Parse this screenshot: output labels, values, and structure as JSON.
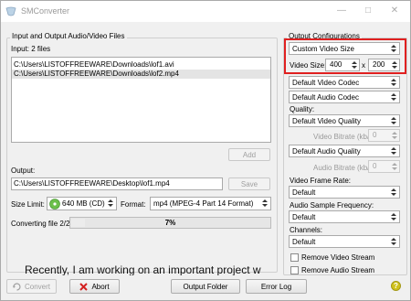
{
  "window": {
    "title": "SMConverter",
    "min_label": "—",
    "max_label": "□",
    "close_label": "✕"
  },
  "io_group": {
    "title": "Input and Output Audio/Video Files",
    "input_label": "Input: 2 files",
    "files": [
      "C:\\Users\\LISTOFFREEWARE\\Downloads\\lof1.avi",
      "C:\\Users\\LISTOFFREEWARE\\Downloads\\lof2.mp4"
    ],
    "add_label": "Add",
    "output_label": "Output:",
    "output_path": "C:\\Users\\LISTOFFREEWARE\\Desktop\\lof1.mp4",
    "save_label": "Save",
    "size_limit_label": "Size Limit:",
    "size_limit_value": "640 MB (CD)",
    "format_label": "Format:",
    "format_value": "mp4 (MPEG-4 Part 14 Format)",
    "converting_label": "Converting file 2/2",
    "progress_text": "7%",
    "progress_fraction": 0.07,
    "preview_text": "Recently, I am working on an important project w"
  },
  "config_group": {
    "title": "Output Configurations",
    "video_size_preset": "Custom Video Size",
    "video_size_label": "Video Size:",
    "video_width": "400",
    "size_x": "x",
    "video_height": "200",
    "video_codec": "Default Video Codec",
    "audio_codec": "Default Audio Codec",
    "quality_label": "Quality:",
    "video_quality": "Default Video Quality",
    "video_bitrate_label": "Video Bitrate (kb/s):",
    "video_bitrate_value": "0",
    "audio_quality": "Default Audio Quality",
    "audio_bitrate_label": "Audio Bitrate (kb/s):",
    "audio_bitrate_value": "0",
    "frame_rate_label": "Video Frame Rate:",
    "frame_rate_value": "Default",
    "sample_freq_label": "Audio Sample Frequency:",
    "sample_freq_value": "Default",
    "channels_label": "Channels:",
    "channels_value": "Default",
    "remove_video_label": "Remove Video Stream",
    "remove_audio_label": "Remove Audio Stream"
  },
  "bottom_bar": {
    "convert_label": "Convert",
    "abort_label": "Abort",
    "output_folder_label": "Output Folder",
    "error_log_label": "Error Log",
    "help_glyph": "?"
  },
  "colors": {
    "highlight": "#e02020",
    "help_icon": "#d0c21c"
  }
}
